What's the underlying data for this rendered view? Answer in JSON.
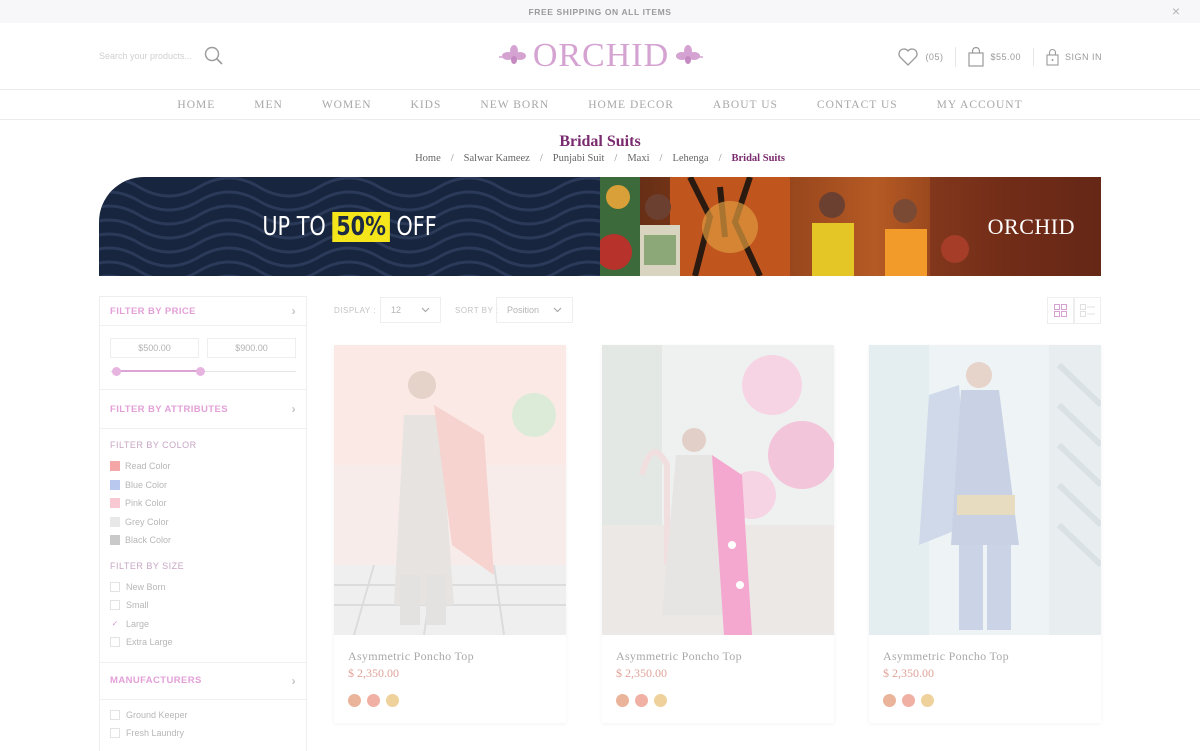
{
  "topbar": {
    "text": "FREE SHIPPING ON ALL ITEMS",
    "close": "×"
  },
  "header": {
    "search_placeholder": "Search your products...",
    "logo_text": "ORCHID",
    "wishlist_count": "(05)",
    "cart_total": "$55.00",
    "sign_in": "SIGN IN"
  },
  "nav": [
    {
      "label": "HOME"
    },
    {
      "label": "MEN"
    },
    {
      "label": "WOMEN"
    },
    {
      "label": "KIDS"
    },
    {
      "label": "NEW BORN"
    },
    {
      "label": "HOME DECOR"
    },
    {
      "label": "ABOUT US"
    },
    {
      "label": "CONTACT US"
    },
    {
      "label": "MY ACCOUNT"
    }
  ],
  "page": {
    "title": "Bridal Suits",
    "breadcrumb": [
      "Home",
      "Salwar Kameez",
      "Punjabi Suit",
      "Maxi",
      "Lehenga"
    ],
    "breadcrumb_active": "Bridal Suits",
    "separator": "/"
  },
  "banner": {
    "promo_pre": "UP TO",
    "promo_highlight": "50%",
    "promo_post": "OFF",
    "logo": "ORCHID",
    "colors": {
      "left_bg": "#17253f",
      "highlight": "#f5e61c"
    }
  },
  "sidebar": {
    "price_heading": "FILTER BY PRICE",
    "price_min": "$500.00",
    "price_max": "$900.00",
    "attributes_heading": "FILTER BY ATTRIBUTES",
    "color_heading": "FILTER BY COLOR",
    "colors": [
      {
        "label": "Read Color",
        "swatch": "#f5a6a6"
      },
      {
        "label": "Blue Color",
        "swatch": "#b9c8ef"
      },
      {
        "label": "Pink Color",
        "swatch": "#f9c9d3"
      },
      {
        "label": "Grey Color",
        "swatch": "#e8e8e8"
      },
      {
        "label": "Black Color",
        "swatch": "#c9c9c9"
      }
    ],
    "size_heading": "FILTER BY SIZE",
    "sizes": [
      {
        "label": "New Born",
        "checked": false
      },
      {
        "label": "Small",
        "checked": false
      },
      {
        "label": "Large",
        "checked": true
      },
      {
        "label": "Extra Large",
        "checked": false
      }
    ],
    "manufacturers_heading": "MANUFACTURERS",
    "manufacturers": [
      {
        "label": "Ground Keeper"
      },
      {
        "label": "Fresh Laundry"
      }
    ]
  },
  "toolbar": {
    "display_label": "DISPLAY :",
    "display_value": "12",
    "sort_label": "SORT BY :",
    "sort_value": "Position"
  },
  "products": [
    {
      "name": "Asymmetric Poncho Top",
      "price": "$ 2,350.00"
    },
    {
      "name": "Asymmetric Poncho Top",
      "price": "$ 2,350.00"
    },
    {
      "name": "Asymmetric Poncho Top",
      "price": "$ 2,350.00"
    }
  ],
  "swatch_dots": [
    "#e9b49a",
    "#f0b0a4",
    "#efd19c"
  ],
  "accent_color": "#7a2a6e"
}
